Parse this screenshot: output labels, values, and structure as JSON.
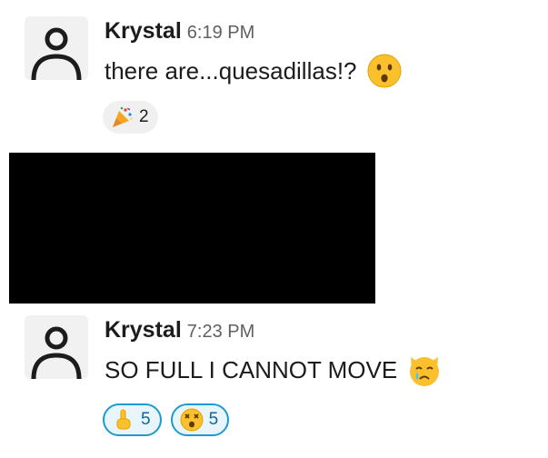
{
  "messages": [
    {
      "author": "Krystal",
      "time": "6:19 PM",
      "text": "there are...quesadillas!?",
      "inline_emoji": "hushed-face",
      "reactions": [
        {
          "emoji": "party-popper",
          "count": "2",
          "reacted_by_me": false
        }
      ]
    },
    {
      "author": "Krystal",
      "time": "7:23 PM",
      "text": "SO FULL I CANNOT MOVE",
      "inline_emoji": "crying-cat-face",
      "reactions": [
        {
          "emoji": "index-pointing-up",
          "count": "5",
          "reacted_by_me": true
        },
        {
          "emoji": "dizzy-face",
          "count": "5",
          "reacted_by_me": true
        }
      ]
    }
  ],
  "colors": {
    "reaction_active_border": "#1d9bd1",
    "reaction_active_bg": "#e8f5fa",
    "reaction_active_text": "#1264a3",
    "redacted_block": "#000000"
  }
}
